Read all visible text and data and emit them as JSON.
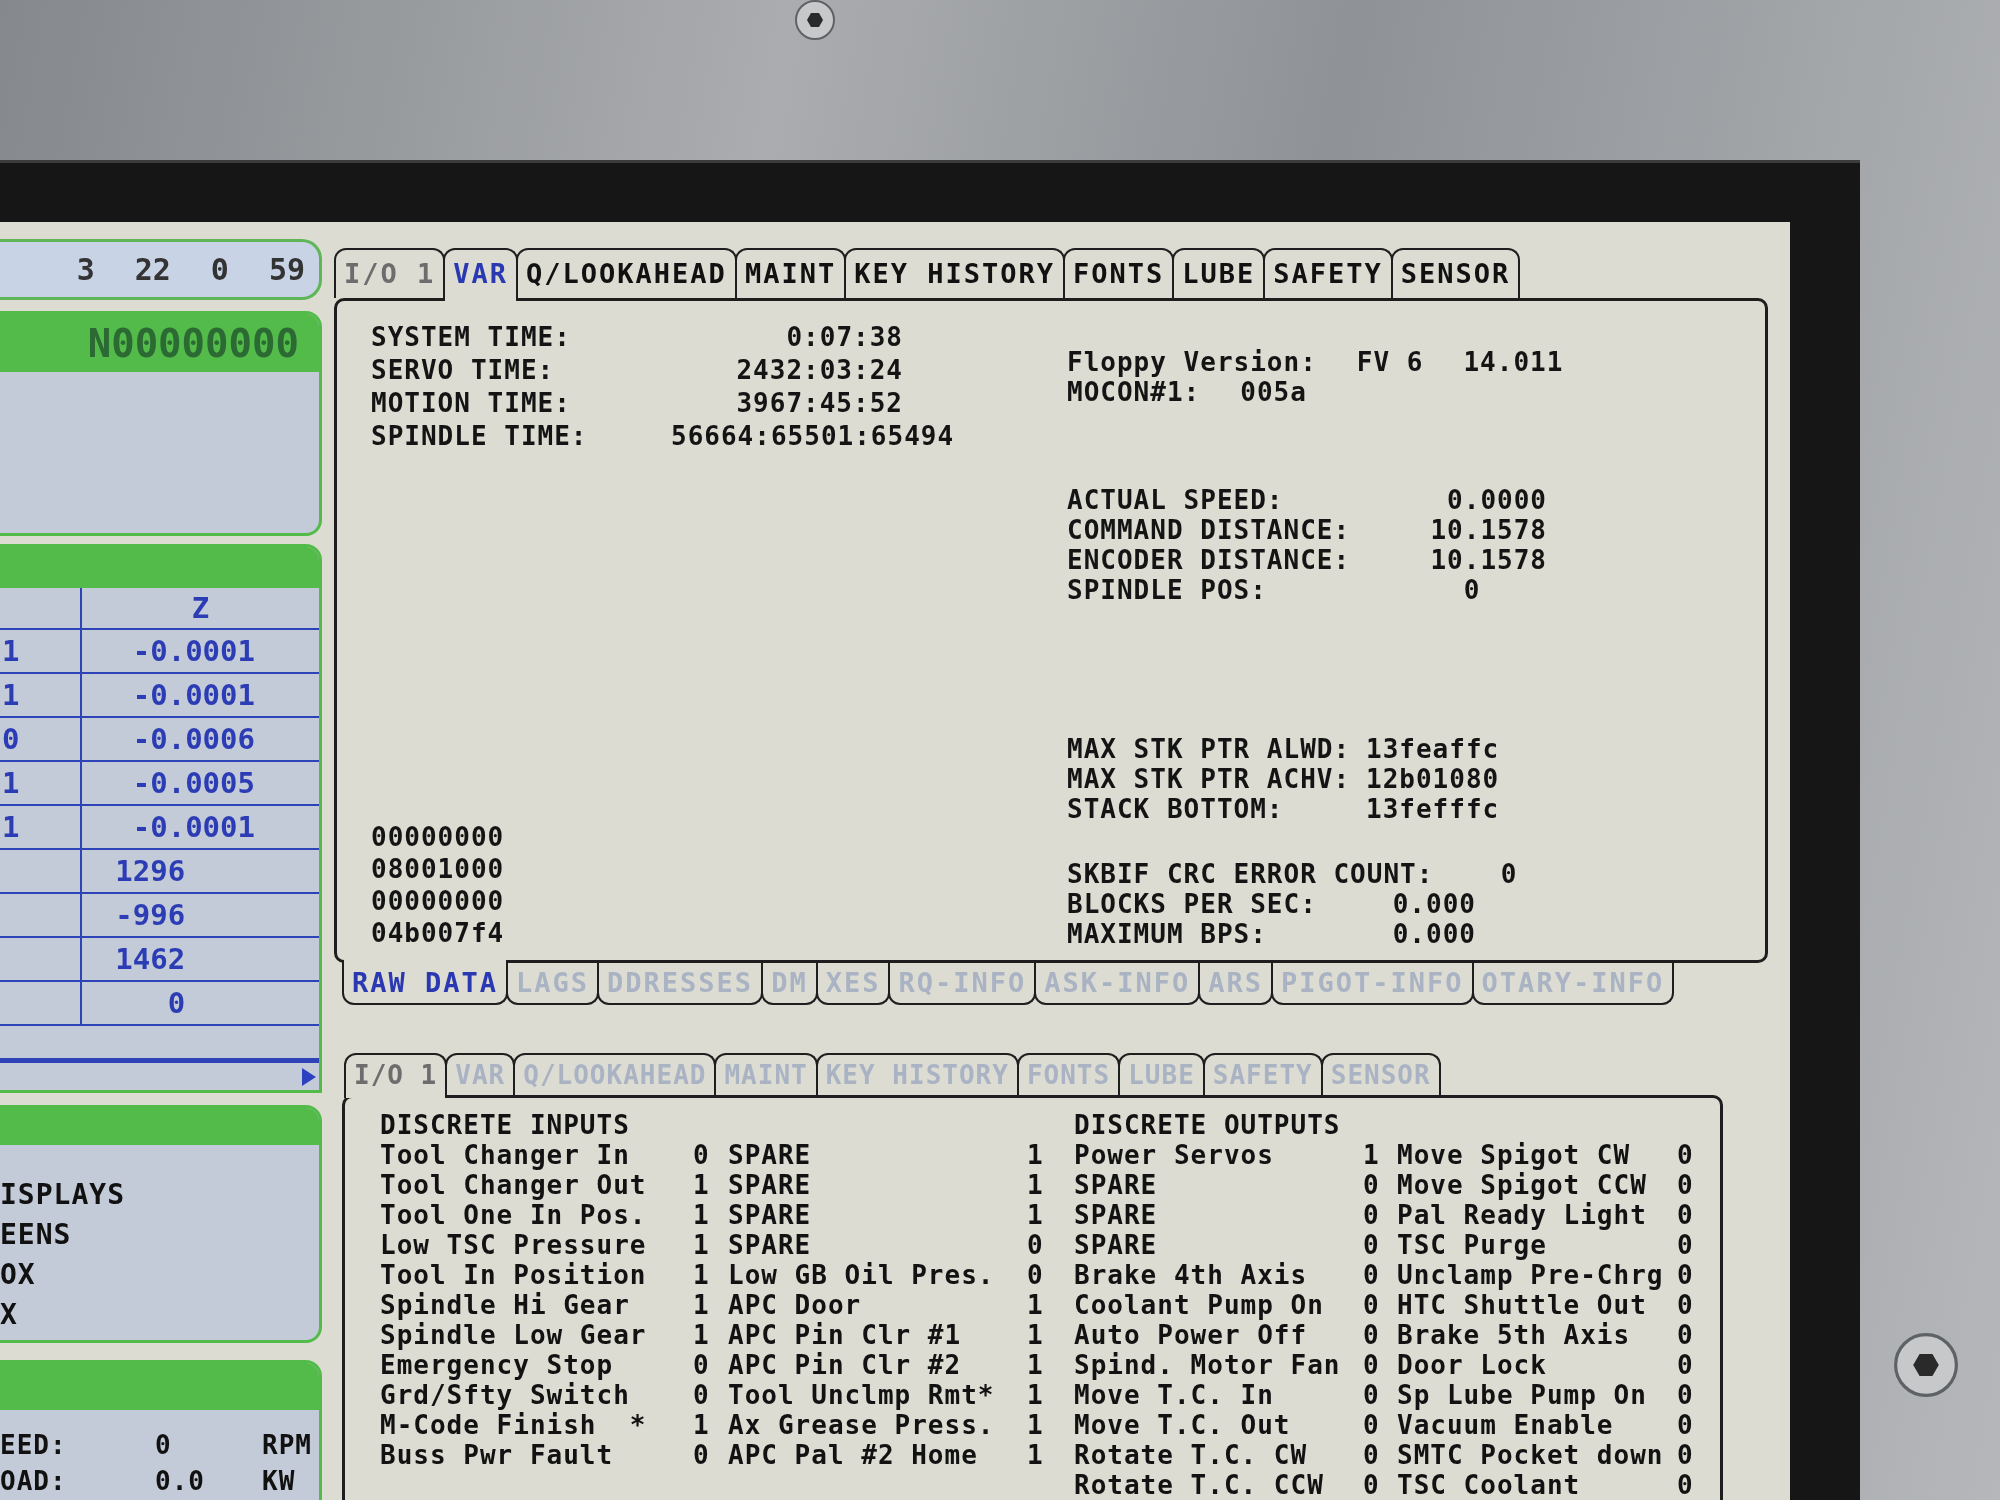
{
  "left_panel": {
    "counters": [
      "3",
      "22",
      "0",
      "59"
    ],
    "program": {
      "block": "N00000000"
    },
    "positions": {
      "header": "Z",
      "rows": [
        {
          "column_1": "1",
          "column_2": "-0.0001"
        },
        {
          "column_1": "1",
          "column_2": "-0.0001"
        },
        {
          "column_1": "0",
          "column_2": "-0.0006"
        },
        {
          "column_1": "1",
          "column_2": "-0.0005"
        },
        {
          "column_1": "1",
          "column_2": "-0.0001"
        },
        {
          "column_2": "1296"
        },
        {
          "column_2": "-996"
        },
        {
          "column_2": "1462"
        },
        {
          "column_2": "0"
        }
      ]
    },
    "menu": {
      "items": [
        "ISPLAYS",
        "EENS",
        "OX",
        "X"
      ]
    },
    "spindle": {
      "rows": [
        {
          "label": "EED:",
          "value": "0",
          "unit": "RPM"
        },
        {
          "label": "OAD:",
          "value": "0.0",
          "unit": "KW"
        }
      ]
    }
  },
  "top_pane": {
    "tabs": [
      {
        "label": "I/O 1",
        "selected": false,
        "dimmed": true,
        "disabled": false
      },
      {
        "label": "VAR",
        "selected": true,
        "dimmed": false,
        "disabled": false
      },
      {
        "label": "Q/LOOKAHEAD",
        "selected": false,
        "dimmed": false,
        "disabled": false
      },
      {
        "label": "MAINT",
        "selected": false,
        "dimmed": false,
        "disabled": false
      },
      {
        "label": "KEY HISTORY",
        "selected": false,
        "dimmed": false,
        "disabled": false
      },
      {
        "label": "FONTS",
        "selected": false,
        "dimmed": false,
        "disabled": false
      },
      {
        "label": "LUBE",
        "selected": false,
        "dimmed": false,
        "disabled": false
      },
      {
        "label": "SAFETY",
        "selected": false,
        "dimmed": false,
        "disabled": false
      },
      {
        "label": "SENSOR",
        "selected": false,
        "dimmed": false,
        "disabled": false
      }
    ],
    "times": [
      {
        "label": "SYSTEM TIME:",
        "value": "0:07:38"
      },
      {
        "label": "SERVO TIME:",
        "value": "2432:03:24"
      },
      {
        "label": "MOTION TIME:",
        "value": "3967:45:52"
      },
      {
        "label": "SPINDLE TIME:",
        "value": "56664:65501:65494"
      }
    ],
    "raw_words": [
      "00000000",
      "08001000",
      "00000000",
      "04b007f4"
    ],
    "versions": [
      {
        "label": "Floppy Version:",
        "values": [
          "FV 6",
          "14.011"
        ]
      },
      {
        "label": "MOCON#1:",
        "values": [
          "005a"
        ]
      }
    ],
    "spindle_status": [
      {
        "label": "ACTUAL SPEED:",
        "value": "0.0000"
      },
      {
        "label": "COMMAND DISTANCE:",
        "value": "10.1578"
      },
      {
        "label": "ENCODER DISTANCE:",
        "value": "10.1578"
      },
      {
        "label": "SPINDLE POS:",
        "value": "0"
      }
    ],
    "stack": [
      {
        "label": "MAX STK PTR ALWD:",
        "value": "13feaffc"
      },
      {
        "label": "MAX STK PTR ACHV:",
        "value": "12b01080"
      },
      {
        "label": "STACK BOTTOM:",
        "value": "13fefffc"
      }
    ],
    "throughput": [
      {
        "label": "SKBIF CRC ERROR COUNT:",
        "value": "0"
      },
      {
        "label": "BLOCKS PER SEC:",
        "value": "0.000"
      },
      {
        "label": "MAXIMUM BPS:",
        "value": "0.000"
      }
    ],
    "subtabs": [
      {
        "label": "RAW DATA",
        "selected": true,
        "dimmed": false,
        "disabled": false
      },
      {
        "label": "LAGS",
        "selected": false,
        "dimmed": false,
        "disabled": true
      },
      {
        "label": "DDRESSES",
        "selected": false,
        "dimmed": false,
        "disabled": true
      },
      {
        "label": "DM",
        "selected": false,
        "dimmed": false,
        "disabled": true
      },
      {
        "label": "XES",
        "selected": false,
        "dimmed": false,
        "disabled": true
      },
      {
        "label": "RQ-INFO",
        "selected": false,
        "dimmed": false,
        "disabled": true
      },
      {
        "label": "ASK-INFO",
        "selected": false,
        "dimmed": false,
        "disabled": true
      },
      {
        "label": "ARS",
        "selected": false,
        "dimmed": false,
        "disabled": true
      },
      {
        "label": "PIGOT-INFO",
        "selected": false,
        "dimmed": false,
        "disabled": true
      },
      {
        "label": "OTARY-INFO",
        "selected": false,
        "dimmed": false,
        "disabled": true
      }
    ]
  },
  "bottom_pane": {
    "tabs": [
      {
        "label": "I/O 1",
        "selected": true,
        "dimmed": true,
        "disabled": false
      },
      {
        "label": "VAR",
        "selected": false,
        "dimmed": false,
        "disabled": true
      },
      {
        "label": "Q/LOOKAHEAD",
        "selected": false,
        "dimmed": false,
        "disabled": true
      },
      {
        "label": "MAINT",
        "selected": false,
        "dimmed": false,
        "disabled": true
      },
      {
        "label": "KEY HISTORY",
        "selected": false,
        "dimmed": false,
        "disabled": true
      },
      {
        "label": "FONTS",
        "selected": false,
        "dimmed": false,
        "disabled": true
      },
      {
        "label": "LUBE",
        "selected": false,
        "dimmed": false,
        "disabled": true
      },
      {
        "label": "SAFETY",
        "selected": false,
        "dimmed": false,
        "disabled": true
      },
      {
        "label": "SENSOR",
        "selected": false,
        "dimmed": false,
        "disabled": true
      }
    ],
    "discrete_inputs": {
      "title": "DISCRETE INPUTS",
      "rows": [
        {
          "name": "Tool Changer In",
          "value": "0",
          "name_2": "SPARE",
          "value_2": "1"
        },
        {
          "name": "Tool Changer Out",
          "value": "1",
          "name_2": "SPARE",
          "value_2": "1"
        },
        {
          "name": "Tool One In Pos.",
          "value": "1",
          "name_2": "SPARE",
          "value_2": "1"
        },
        {
          "name": "Low TSC Pressure",
          "value": "1",
          "name_2": "SPARE",
          "value_2": "0"
        },
        {
          "name": "Tool In Position",
          "value": "1",
          "name_2": "Low GB Oil Pres.",
          "value_2": "0"
        },
        {
          "name": "Spindle Hi Gear",
          "value": "1",
          "name_2": "APC Door",
          "value_2": "1"
        },
        {
          "name": "Spindle Low Gear",
          "value": "1",
          "name_2": "APC Pin Clr #1",
          "value_2": "1"
        },
        {
          "name": "Emergency Stop",
          "value": "0",
          "name_2": "APC Pin Clr #2",
          "value_2": "1"
        },
        {
          "name": "Grd/Sfty Switch",
          "value": "0",
          "name_2": "Tool Unclmp Rmt*",
          "value_2": "1"
        },
        {
          "name": "M-Code Finish  *",
          "value": "1",
          "name_2": "Ax Grease Press.",
          "value_2": "1"
        },
        {
          "name": "Buss Pwr Fault",
          "value": "0",
          "name_2": "APC Pal #2 Home",
          "value_2": "1"
        }
      ]
    },
    "discrete_outputs": {
      "title": "DISCRETE OUTPUTS",
      "rows": [
        {
          "name": "Power Servos",
          "value": "1",
          "name_2": "Move Spigot CW",
          "value_2": "0"
        },
        {
          "name": "SPARE",
          "value": "0",
          "name_2": "Move Spigot CCW",
          "value_2": "0"
        },
        {
          "name": "SPARE",
          "value": "0",
          "name_2": "Pal Ready Light",
          "value_2": "0"
        },
        {
          "name": "SPARE",
          "value": "0",
          "name_2": "TSC Purge",
          "value_2": "0"
        },
        {
          "name": "Brake 4th Axis",
          "value": "0",
          "name_2": "Unclamp Pre-Chrg",
          "value_2": "0"
        },
        {
          "name": "Coolant Pump On",
          "value": "0",
          "name_2": "HTC Shuttle Out",
          "value_2": "0"
        },
        {
          "name": "Auto Power Off",
          "value": "0",
          "name_2": "Brake 5th Axis",
          "value_2": "0"
        },
        {
          "name": "Spind. Motor Fan",
          "value": "0",
          "name_2": "Door Lock",
          "value_2": "0"
        },
        {
          "name": "Move T.C. In",
          "value": "0",
          "name_2": "Sp Lube Pump On",
          "value_2": "0"
        },
        {
          "name": "Move T.C. Out",
          "value": "0",
          "name_2": "Vacuum Enable",
          "value_2": "0"
        },
        {
          "name": "Rotate T.C. CW",
          "value": "0",
          "name_2": "SMTC Pocket down",
          "value_2": "0"
        },
        {
          "name": "Rotate T.C. CCW",
          "value": "0",
          "name_2": "TSC Coolant",
          "value_2": "0"
        }
      ]
    }
  }
}
